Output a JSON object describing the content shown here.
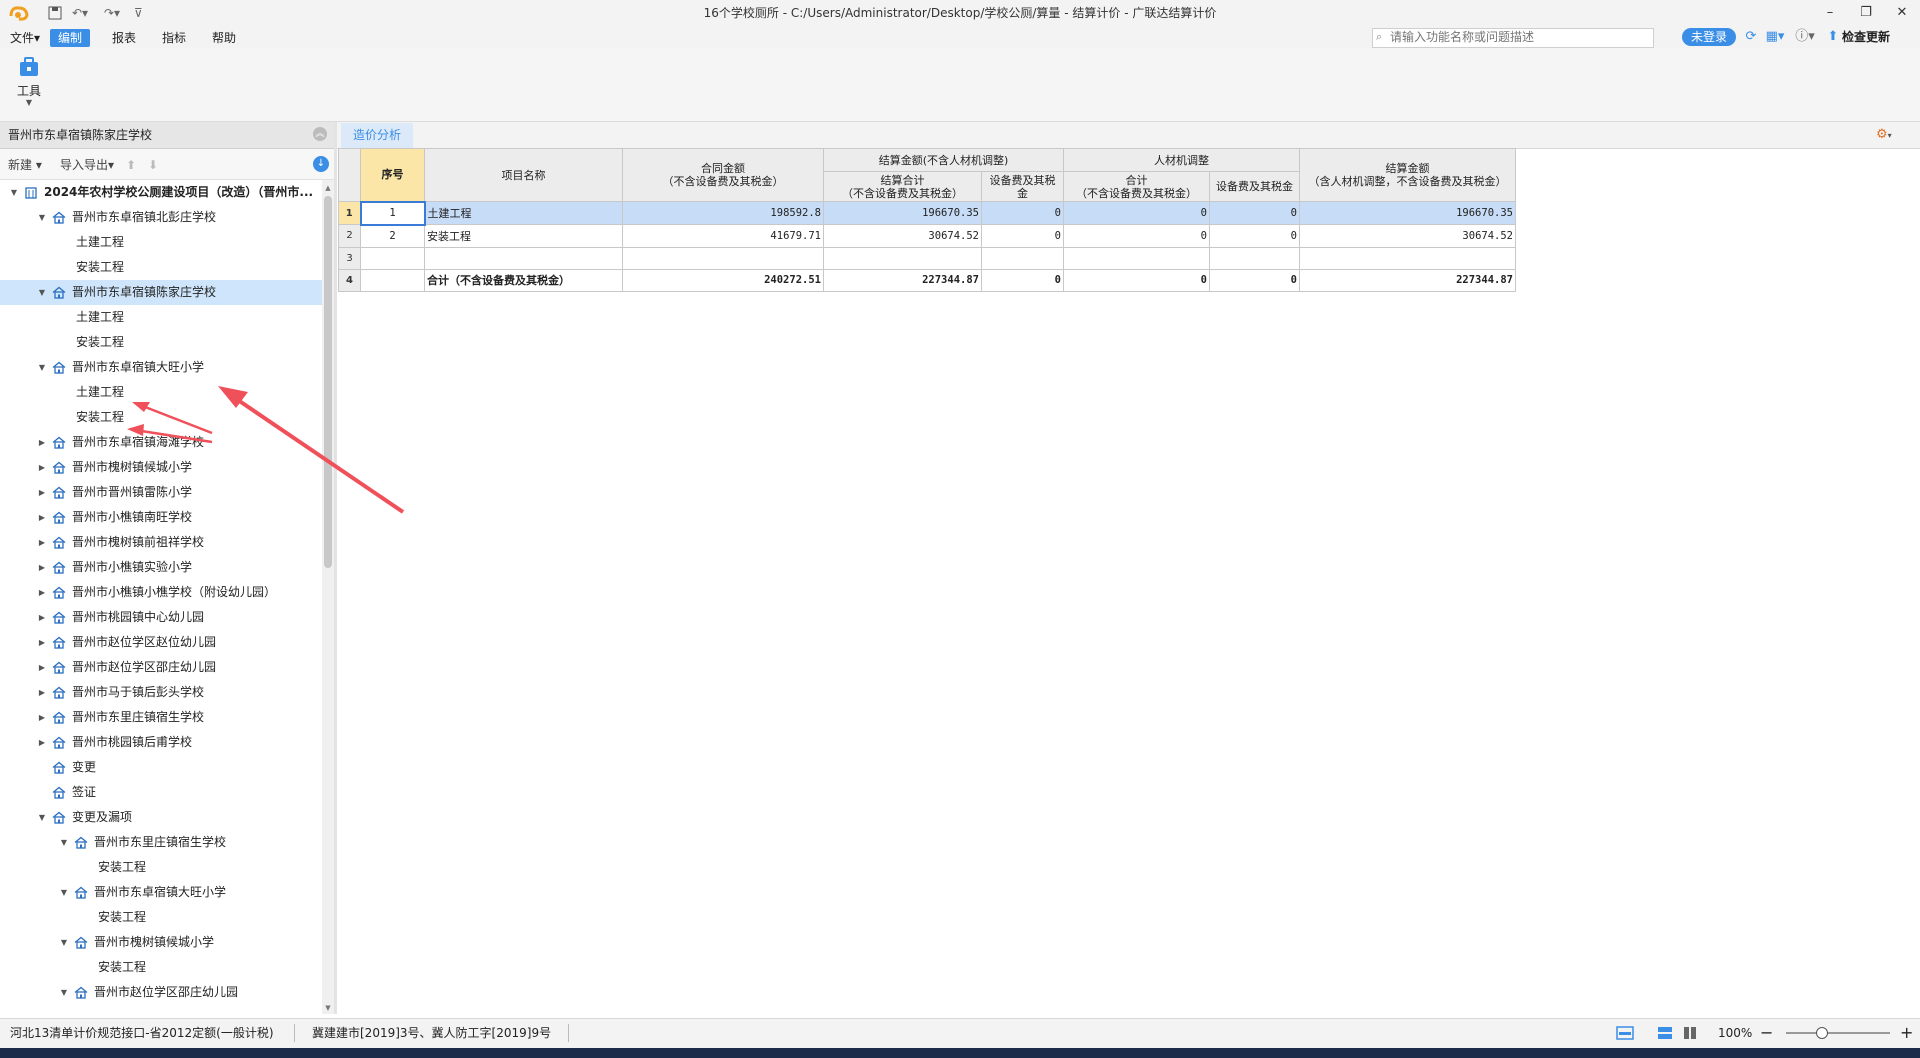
{
  "window": {
    "title": "16个学校厕所 - C:/Users/Administrator/Desktop/学校公厕/算量 - 结算计价 - 广联达结算计价"
  },
  "menu": {
    "file": "文件▾",
    "edit": "编制",
    "report": "报表",
    "indicator": "指标",
    "help": "帮助"
  },
  "search": {
    "placeholder": "请输入功能名称或问题描述"
  },
  "account": {
    "login": "未登录",
    "update": "检查更新"
  },
  "ribbon": {
    "tools_label": "工具"
  },
  "left_panel": {
    "title": "晋州市东卓宿镇陈家庄学校",
    "new_label": "新建",
    "import_export_label": "导入导出",
    "tree": [
      {
        "label": "2024年农村学校公厕建设项目（改造）（晋州市...",
        "level": 0,
        "state": "expanded",
        "icon": "project-icon",
        "bold": true
      },
      {
        "label": "晋州市东卓宿镇北彭庄学校",
        "level": 1,
        "state": "expanded",
        "icon": "home-icon"
      },
      {
        "label": "土建工程",
        "level": 2,
        "state": "leaf"
      },
      {
        "label": "安装工程",
        "level": 2,
        "state": "leaf"
      },
      {
        "label": "晋州市东卓宿镇陈家庄学校",
        "level": 1,
        "state": "expanded",
        "icon": "home-icon",
        "selected": true
      },
      {
        "label": "土建工程",
        "level": 2,
        "state": "leaf"
      },
      {
        "label": "安装工程",
        "level": 2,
        "state": "leaf"
      },
      {
        "label": "晋州市东卓宿镇大旺小学",
        "level": 1,
        "state": "expanded",
        "icon": "home-icon"
      },
      {
        "label": "土建工程",
        "level": 2,
        "state": "leaf"
      },
      {
        "label": "安装工程",
        "level": 2,
        "state": "leaf"
      },
      {
        "label": "晋州市东卓宿镇海滩学校",
        "level": 1,
        "state": "collapsed",
        "icon": "home-icon"
      },
      {
        "label": "晋州市槐树镇候城小学",
        "level": 1,
        "state": "collapsed",
        "icon": "home-icon"
      },
      {
        "label": "晋州市晋州镇雷陈小学",
        "level": 1,
        "state": "collapsed",
        "icon": "home-icon"
      },
      {
        "label": "晋州市小樵镇南旺学校",
        "level": 1,
        "state": "collapsed",
        "icon": "home-icon"
      },
      {
        "label": "晋州市槐树镇前祖祥学校",
        "level": 1,
        "state": "collapsed",
        "icon": "home-icon"
      },
      {
        "label": "晋州市小樵镇实验小学",
        "level": 1,
        "state": "collapsed",
        "icon": "home-icon"
      },
      {
        "label": "晋州市小樵镇小樵学校（附设幼儿园）",
        "level": 1,
        "state": "collapsed",
        "icon": "home-icon"
      },
      {
        "label": "晋州市桃园镇中心幼儿园",
        "level": 1,
        "state": "collapsed",
        "icon": "home-icon"
      },
      {
        "label": "晋州市赵位学区赵位幼儿园",
        "level": 1,
        "state": "collapsed",
        "icon": "home-icon"
      },
      {
        "label": "晋州市赵位学区邵庄幼儿园",
        "level": 1,
        "state": "collapsed",
        "icon": "home-icon"
      },
      {
        "label": "晋州市马于镇后彭头学校",
        "level": 1,
        "state": "collapsed",
        "icon": "home-icon"
      },
      {
        "label": "晋州市东里庄镇宿生学校",
        "level": 1,
        "state": "collapsed",
        "icon": "home-icon"
      },
      {
        "label": "晋州市桃园镇后甫学校",
        "level": 1,
        "state": "collapsed",
        "icon": "home-icon"
      },
      {
        "label": "变更",
        "level": 1,
        "state": "none",
        "icon": "home-icon"
      },
      {
        "label": "签证",
        "level": 1,
        "state": "none",
        "icon": "home-icon"
      },
      {
        "label": "变更及漏项",
        "level": 1,
        "state": "expanded",
        "icon": "home-icon"
      },
      {
        "label": "晋州市东里庄镇宿生学校",
        "level": 2,
        "state": "expanded",
        "icon": "home-icon"
      },
      {
        "label": "安装工程",
        "level": 3,
        "state": "leaf"
      },
      {
        "label": "晋州市东卓宿镇大旺小学",
        "level": 2,
        "state": "expanded",
        "icon": "home-icon"
      },
      {
        "label": "安装工程",
        "level": 3,
        "state": "leaf"
      },
      {
        "label": "晋州市槐树镇候城小学",
        "level": 2,
        "state": "expanded",
        "icon": "home-icon"
      },
      {
        "label": "安装工程",
        "level": 3,
        "state": "leaf"
      },
      {
        "label": "晋州市赵位学区邵庄幼儿园",
        "level": 2,
        "state": "expanded",
        "icon": "home-icon"
      }
    ]
  },
  "tab": {
    "label": "造价分析"
  },
  "grid": {
    "headers": {
      "seq": "序号",
      "name": "项目名称",
      "contract": [
        "合同金额",
        "（不含设备费及其税金）"
      ],
      "settle_group": "结算金额(不含人材机调整)",
      "settle_total": [
        "结算合计",
        "（不含设备费及其税金）"
      ],
      "settle_equip": [
        "设备费及其税",
        "金"
      ],
      "adj_group": "人材机调整",
      "adj_total": [
        "合计",
        "（不含设备费及其税金）"
      ],
      "adj_equip": "设备费及其税金",
      "final": [
        "结算金额",
        "（含人材机调整，不含设备费及其税金）"
      ]
    },
    "rows": [
      {
        "rownum": "1",
        "seq": "1",
        "name": "土建工程",
        "contract": "198592.8",
        "settle_total": "196670.35",
        "settle_equip": "0",
        "adj_total": "0",
        "adj_equip": "0",
        "final": "196670.35"
      },
      {
        "rownum": "2",
        "seq": "2",
        "name": "安装工程",
        "contract": "41679.71",
        "settle_total": "30674.52",
        "settle_equip": "0",
        "adj_total": "0",
        "adj_equip": "0",
        "final": "30674.52"
      },
      {
        "rownum": "3",
        "seq": "",
        "name": "",
        "contract": "",
        "settle_total": "",
        "settle_equip": "",
        "adj_total": "",
        "adj_equip": "",
        "final": ""
      },
      {
        "rownum": "4",
        "seq": "",
        "name": "合计（不含设备费及其税金）",
        "contract": "240272.51",
        "settle_total": "227344.87",
        "settle_equip": "0",
        "adj_total": "0",
        "adj_equip": "0",
        "final": "227344.87"
      }
    ]
  },
  "status": {
    "left": "河北13清单计价规范接口-省2012定额(一般计税)",
    "middle": "冀建建市[2019]3号、冀人防工字[2019]9号",
    "zoom": "100%"
  },
  "colors": {
    "accent": "#3a8ee6",
    "selection": "#cfe5fb",
    "annotation_arrow": "#f0505a"
  }
}
